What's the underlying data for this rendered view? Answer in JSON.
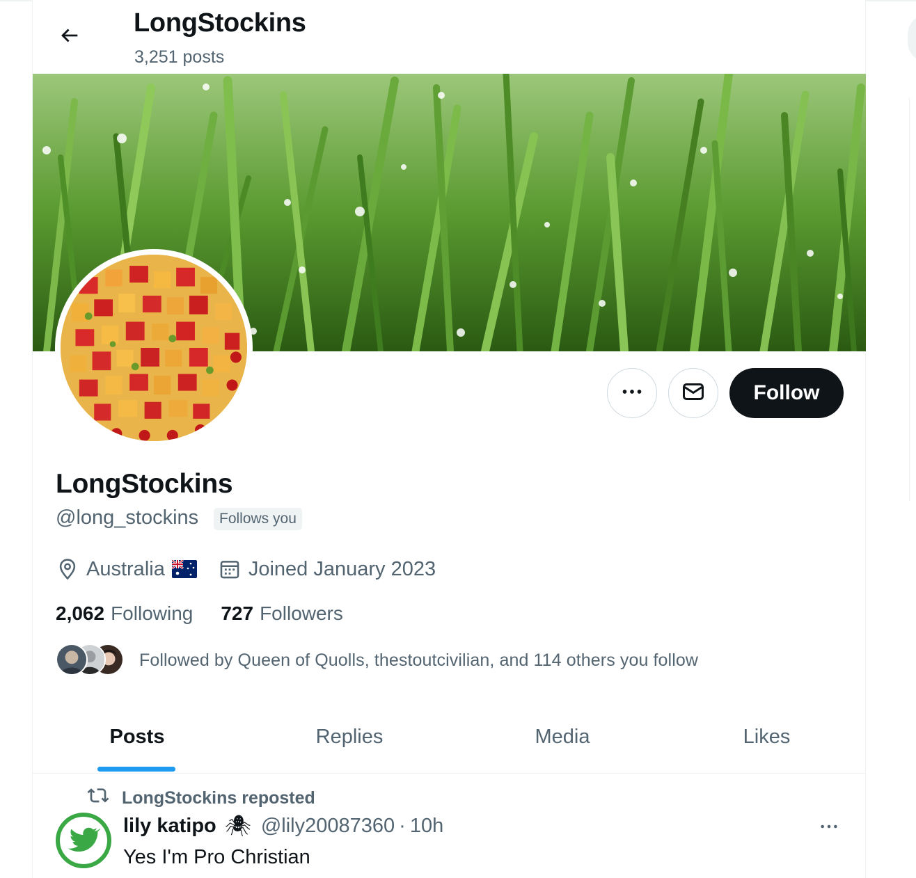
{
  "header": {
    "title": "LongStockins",
    "posts_count": "3,251 posts",
    "back_icon": "arrow-left-icon"
  },
  "profile": {
    "name": "LongStockins",
    "handle": "@long_stockins",
    "follows_you": "Follows you",
    "location": "Australia",
    "joined": "Joined January 2023",
    "following_count": "2,062",
    "following_label": "Following",
    "followers_count": "727",
    "followers_label": "Followers",
    "followed_by": "Followed by Queen of Quolls, thestoutcivilian, and 114 others you follow"
  },
  "actions": {
    "more_icon": "more-horizontal-icon",
    "message_icon": "envelope-icon",
    "follow_label": "Follow"
  },
  "tabs": [
    {
      "label": "Posts",
      "active": true
    },
    {
      "label": "Replies",
      "active": false
    },
    {
      "label": "Media",
      "active": false
    },
    {
      "label": "Likes",
      "active": false
    }
  ],
  "post": {
    "repost_label": "LongStockins reposted",
    "author": "lily katipo",
    "emoji": "🕷",
    "handle": "@lily20087360",
    "separator": "·",
    "time": "10h",
    "text": "Yes I'm Pro Christian"
  },
  "colors": {
    "accent": "#1d9bf0",
    "text_primary": "#0f1419",
    "text_secondary": "#536471",
    "follow_bg": "#0f1419",
    "post_avatar_ring": "#3aa845"
  }
}
